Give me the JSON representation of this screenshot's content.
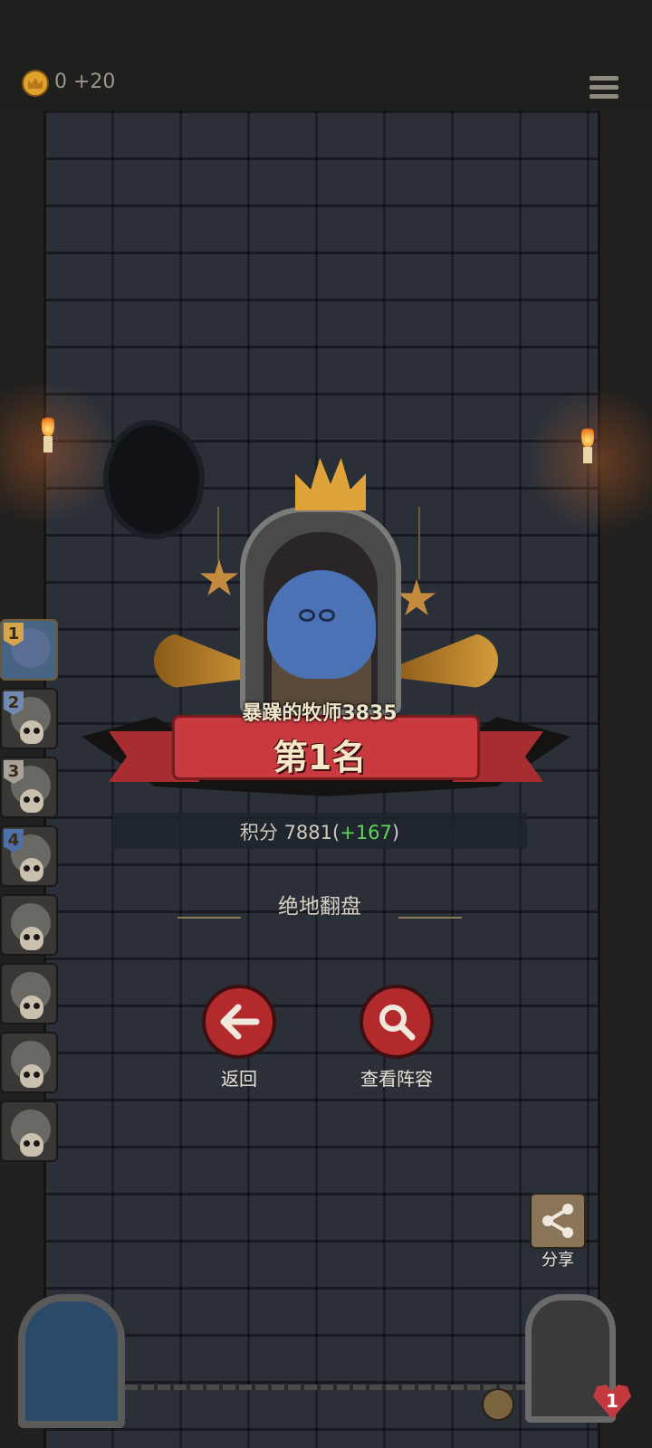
{
  "top_bar": {
    "coin_icon": "crown-coin-icon",
    "coin_text": "0 +20",
    "menu_icon": "hamburger-menu-icon"
  },
  "ranking_list": {
    "items": [
      {
        "rank": "1",
        "active": true
      },
      {
        "rank": "2",
        "active": false
      },
      {
        "rank": "3",
        "active": false
      },
      {
        "rank": "4",
        "active": false
      },
      {
        "rank": "",
        "active": false
      },
      {
        "rank": "",
        "active": false
      },
      {
        "rank": "",
        "active": false
      },
      {
        "rank": "",
        "active": false
      }
    ]
  },
  "result": {
    "player_name": "暴躁的牧师3835",
    "rank_title": "第1名",
    "score_label": "积分 7881",
    "score_delta_open": "(",
    "score_delta": "+167",
    "score_delta_close": ")",
    "achievement": "绝地翻盘"
  },
  "actions": {
    "back_label": "返回",
    "view_lineup_label": "查看阵容",
    "share_label": "分享"
  },
  "bottom": {
    "lives": "1"
  },
  "colors": {
    "accent_red": "#b22a2c",
    "score_green": "#5fd35f",
    "gold": "#e0a33a"
  }
}
